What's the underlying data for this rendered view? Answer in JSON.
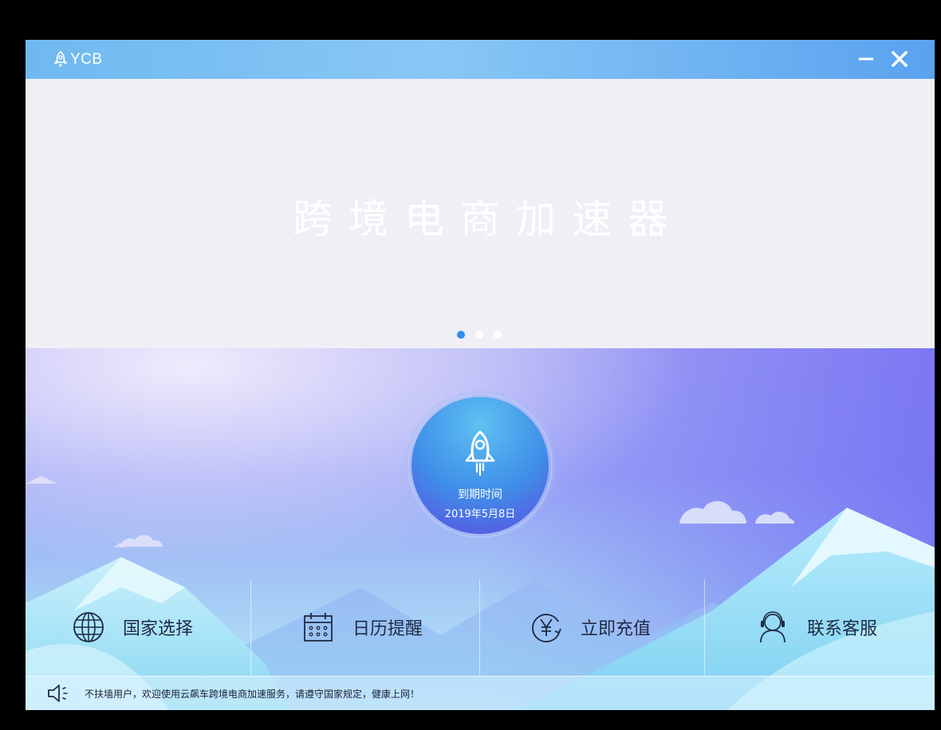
{
  "app": {
    "name": "YCB"
  },
  "window_controls": {
    "minimize_icon": "minus-icon",
    "close_icon": "close-icon"
  },
  "banner": {
    "title": "跨境电商加速器",
    "carousel_dots": 3,
    "active_dot": 1
  },
  "accelerator": {
    "label": "到期时间",
    "expiry_date": "2019年5月8日",
    "icon": "rocket-icon"
  },
  "menu": [
    {
      "label": "国家选择",
      "icon": "globe-icon"
    },
    {
      "label": "日历提醒",
      "icon": "calendar-icon"
    },
    {
      "label": "立即充值",
      "icon": "yen-recharge-icon"
    },
    {
      "label": "联系客服",
      "icon": "headset-icon"
    }
  ],
  "notice": {
    "icon": "speaker-icon",
    "text": "不扶墙用户，欢迎使用云飙车跨境电商加速服务，请遵守国家规定，健康上网！"
  },
  "colors": {
    "titlebar": "#6fb9f0",
    "accent": "#2e8fe6",
    "scene_top": "#8c8cf5",
    "scene_bottom": "#8fd6f5"
  }
}
